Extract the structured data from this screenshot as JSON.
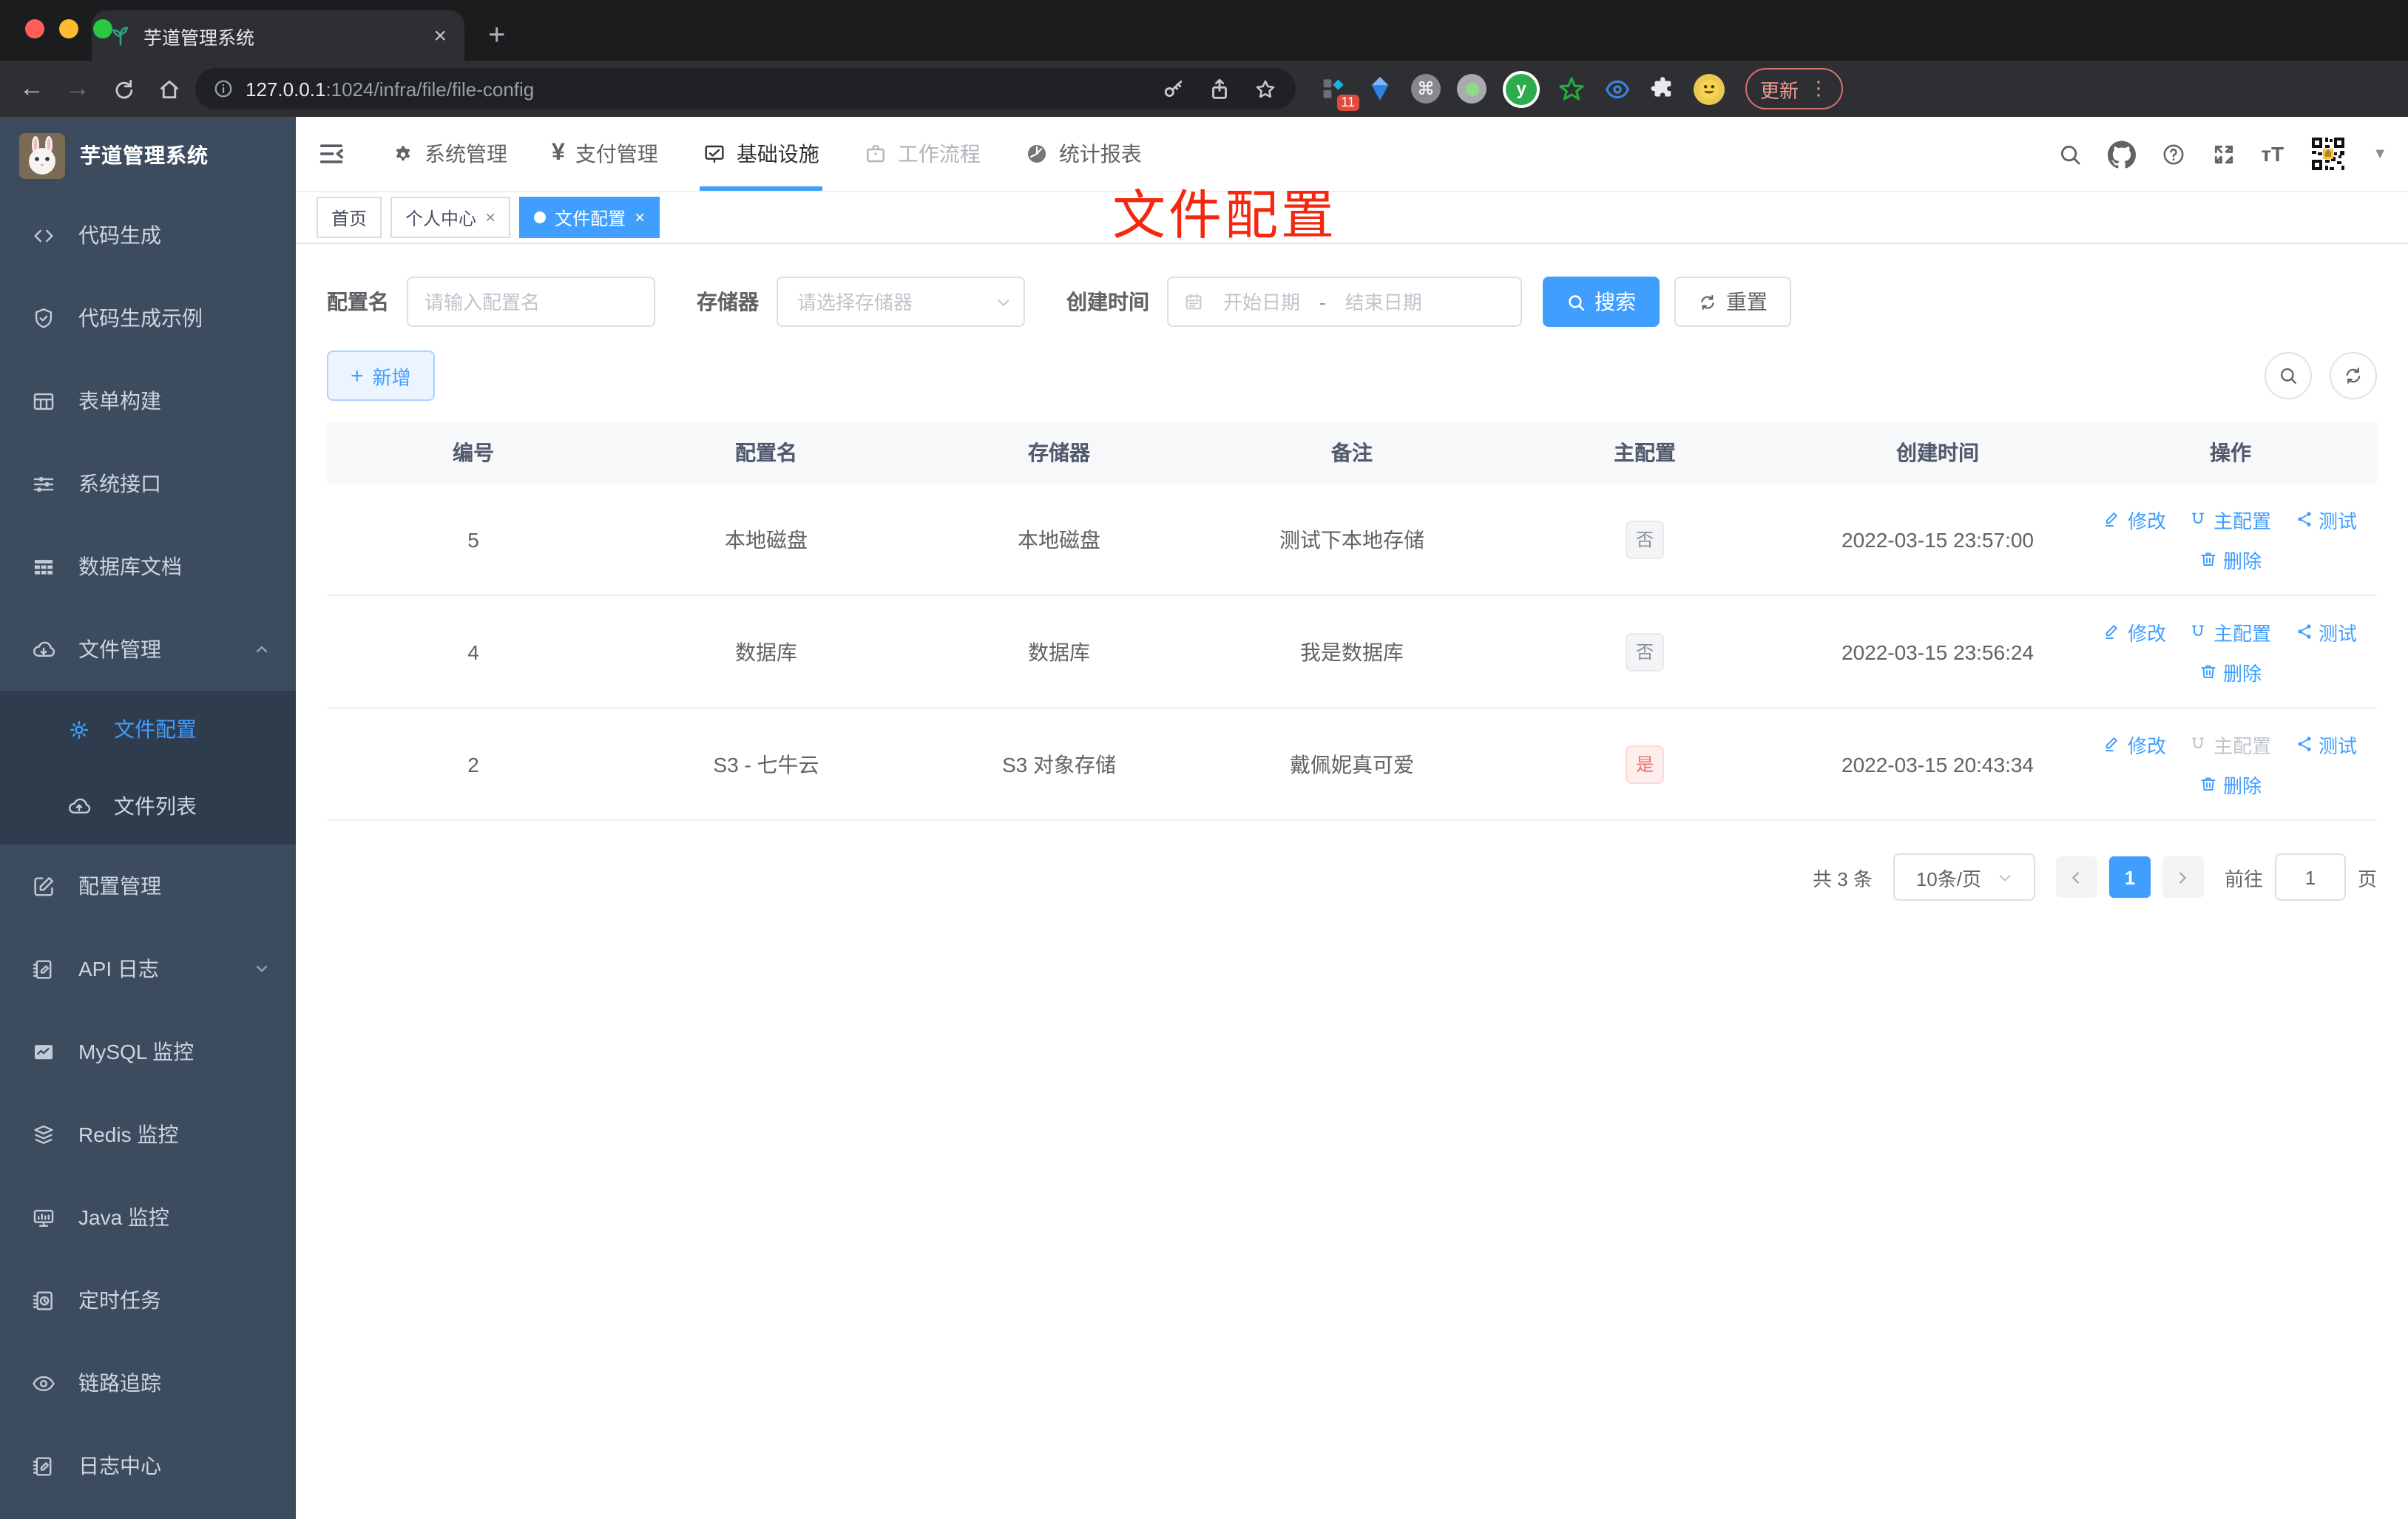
{
  "browser": {
    "tab_title": "芋道管理系统",
    "url_host": "127.0.0.1",
    "url_rest": ":1024/infra/file/file-config",
    "extension_badge": "11",
    "update_label": "更新",
    "traffic_light_colors": [
      "#ff5f57",
      "#febc2e",
      "#28c840"
    ]
  },
  "app": {
    "logo_title": "芋道管理系统",
    "sidebar": [
      {
        "label": "代码生成",
        "icon": "code"
      },
      {
        "label": "代码生成示例",
        "icon": "shield-check"
      },
      {
        "label": "表单构建",
        "icon": "form-table"
      },
      {
        "label": "系统接口",
        "icon": "sliders"
      },
      {
        "label": "数据库文档",
        "icon": "grid"
      },
      {
        "label": "文件管理",
        "icon": "cloud-download",
        "expanded": true,
        "children": [
          {
            "label": "文件配置",
            "icon": "gear",
            "active": true
          },
          {
            "label": "文件列表",
            "icon": "cloud-upload"
          }
        ]
      },
      {
        "label": "配置管理",
        "icon": "edit-square"
      },
      {
        "label": "API 日志",
        "icon": "doc-edit",
        "collapsed": true
      },
      {
        "label": "MySQL 监控",
        "icon": "chart-monitor"
      },
      {
        "label": "Redis 监控",
        "icon": "layers"
      },
      {
        "label": "Java 监控",
        "icon": "monitor"
      },
      {
        "label": "定时任务",
        "icon": "schedule"
      },
      {
        "label": "链路追踪",
        "icon": "eye"
      },
      {
        "label": "日志中心",
        "icon": "doc-edit"
      }
    ],
    "topnav": [
      {
        "label": "系统管理",
        "icon": "gear"
      },
      {
        "label": "支付管理",
        "icon": "yen"
      },
      {
        "label": "基础设施",
        "icon": "monitor-check",
        "active": true
      },
      {
        "label": "工作流程",
        "icon": "briefcase"
      },
      {
        "label": "统计报表",
        "icon": "dashboard"
      }
    ],
    "tabs": [
      {
        "label": "首页",
        "closable": false,
        "active": false
      },
      {
        "label": "个人中心",
        "closable": true,
        "active": false
      },
      {
        "label": "文件配置",
        "closable": true,
        "active": true
      }
    ],
    "annotation": "文件配置",
    "filters": {
      "name_label": "配置名",
      "name_placeholder": "请输入配置名",
      "storage_label": "存储器",
      "storage_placeholder": "请选择存储器",
      "time_label": "创建时间",
      "start_placeholder": "开始日期",
      "range_separator": "-",
      "end_placeholder": "结束日期",
      "search_label": "搜索",
      "reset_label": "重置"
    },
    "toolbar": {
      "add_label": "新增"
    },
    "table": {
      "columns": [
        "编号",
        "配置名",
        "存储器",
        "备注",
        "主配置",
        "创建时间",
        "操作"
      ],
      "actions": {
        "edit": "修改",
        "master": "主配置",
        "test": "测试",
        "delete": "删除"
      },
      "rows": [
        {
          "id": "5",
          "name": "本地磁盘",
          "storage": "本地磁盘",
          "remark": "测试下本地存储",
          "master": "否",
          "master_type": "info",
          "created": "2022-03-15 23:57:00",
          "master_action_disabled": false
        },
        {
          "id": "4",
          "name": "数据库",
          "storage": "数据库",
          "remark": "我是数据库",
          "master": "否",
          "master_type": "info",
          "created": "2022-03-15 23:56:24",
          "master_action_disabled": false
        },
        {
          "id": "2",
          "name": "S3 - 七牛云",
          "storage": "S3 对象存储",
          "remark": "戴佩妮真可爱",
          "master": "是",
          "master_type": "danger",
          "created": "2022-03-15 20:43:34",
          "master_action_disabled": true
        }
      ]
    },
    "pagination": {
      "total": "共 3 条",
      "page_size": "10条/页",
      "current_page": "1",
      "goto_label": "前往",
      "goto_value": "1",
      "goto_suffix": "页"
    },
    "colors": {
      "primary": "#409eff",
      "danger": "#f56c6c",
      "annotation_red": "#f5270e",
      "sidebar_bg": "#3c4b5e"
    }
  }
}
